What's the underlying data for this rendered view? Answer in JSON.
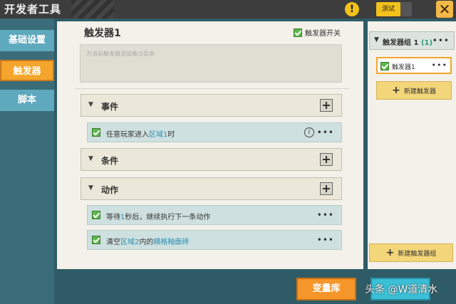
{
  "window": {
    "title": "开发者工具",
    "test_label": "测试",
    "warning_icon": "warning-icon",
    "close_icon": "close-icon"
  },
  "tabs": [
    {
      "label": "基础设置",
      "active": false
    },
    {
      "label": "触发器",
      "active": true
    },
    {
      "label": "脚本",
      "active": false
    }
  ],
  "editor": {
    "title": "触发器1",
    "switch_label": "触发器开关",
    "switch_checked": true,
    "note_placeholder": "为当前触发器添加备注信息",
    "sections": [
      {
        "label": "事件",
        "items": [
          {
            "pre": "任意玩家进入",
            "hl": "区域1",
            "post": "时",
            "checked": true,
            "has_info": true
          }
        ]
      },
      {
        "label": "条件",
        "items": []
      },
      {
        "label": "动作",
        "items": [
          {
            "pre": "等待",
            "hl": "1",
            "post": "秒后，继续执行下一条动作",
            "checked": true,
            "has_info": false
          },
          {
            "pre": "清空",
            "hl": "区域2",
            "mid": "内的",
            "hl2": "横格釉面砖",
            "checked": true,
            "has_info": false
          }
        ]
      }
    ]
  },
  "sidebar": {
    "group_label": "触发器组 1",
    "group_count": "(1)",
    "trigger_label": "触发器1",
    "add_trigger_label": "新建触发器",
    "add_group_label": "新建触发器组"
  },
  "footer": {
    "variable_library_label": "变量库"
  },
  "watermark": "头条 @W道清水",
  "colors": {
    "accent": "#f4a52b",
    "tab": "#5ea9bd",
    "highlight": "#2a8fb5"
  }
}
